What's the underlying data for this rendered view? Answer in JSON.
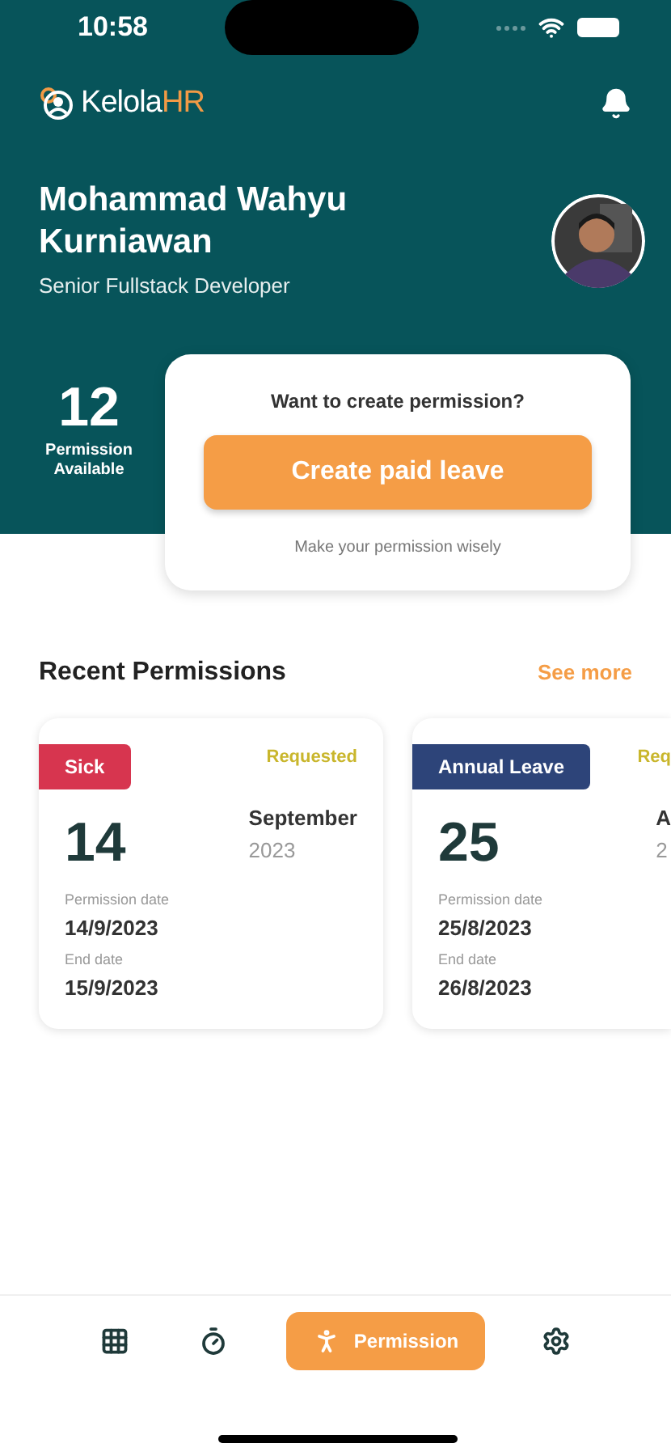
{
  "status_bar": {
    "time": "10:58"
  },
  "header": {
    "brand": {
      "name": "Kelola",
      "accent": "HR"
    },
    "user_name": "Mohammad Wahyu Kurniawan",
    "role": "Senior Fullstack Developer"
  },
  "balance": {
    "count": "12",
    "label": "Permission Available"
  },
  "create_card": {
    "prompt": "Want to create permission?",
    "button": "Create paid leave",
    "hint": "Make your permission wisely"
  },
  "recent": {
    "title": "Recent Permissions",
    "link": "See more",
    "cards": [
      {
        "type": "Sick",
        "color": "#d7354f",
        "status": "Requested",
        "day": "14",
        "month": "September",
        "year": "2023",
        "date_label": "Permission date",
        "date": "14/9/2023",
        "end_label": "End date",
        "end": "15/9/2023"
      },
      {
        "type": "Annual Leave",
        "color": "#2d4479",
        "status": "Req",
        "day": "25",
        "month": "A",
        "year": "2",
        "date_label": "Permission date",
        "date": "25/8/2023",
        "end_label": "End date",
        "end": "26/8/2023"
      }
    ]
  },
  "nav": [
    {
      "kind": "grid",
      "selected": false
    },
    {
      "kind": "stopwatch",
      "selected": false
    },
    {
      "kind": "person",
      "label": "Permission",
      "selected": true
    },
    {
      "kind": "settings",
      "selected": false
    }
  ]
}
